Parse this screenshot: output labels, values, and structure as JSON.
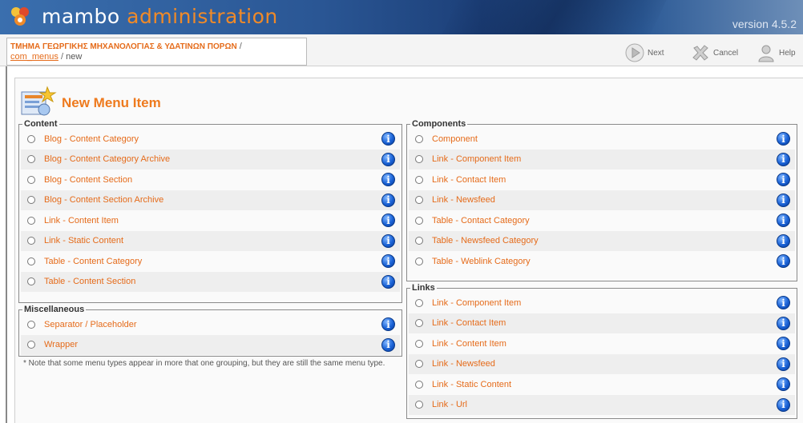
{
  "header": {
    "brand_main": "mambo ",
    "brand_accent": "administration",
    "version": "version 4.5.2"
  },
  "breadcrumb": {
    "site": "ΤΜΗΜΑ ΓΕΩΡΓΙΚΗΣ ΜΗΧΑΝΟΛΟΓΙΑΣ & ΥΔΑΤΙΝΩΝ ΠΟΡΩΝ",
    "separator": " / ",
    "component": "com_menus",
    "task": "new"
  },
  "toolbar": {
    "next": "Next",
    "cancel": "Cancel",
    "help": "Help"
  },
  "page": {
    "title": "New Menu Item",
    "note": "* Note that some menu types appear in more that one grouping, but they are still the same menu type."
  },
  "groups": {
    "content": {
      "legend": "Content",
      "items": [
        "Blog - Content Category",
        "Blog - Content Category Archive",
        "Blog - Content Section",
        "Blog - Content Section Archive",
        "Link - Content Item",
        "Link - Static Content",
        "Table - Content Category",
        "Table - Content Section"
      ]
    },
    "misc": {
      "legend": "Miscellaneous",
      "items": [
        "Separator / Placeholder",
        "Wrapper"
      ]
    },
    "components": {
      "legend": "Components",
      "items": [
        "Component",
        "Link - Component Item",
        "Link - Contact Item",
        "Link - Newsfeed",
        "Table - Contact Category",
        "Table - Newsfeed Category",
        "Table - Weblink Category"
      ]
    },
    "links": {
      "legend": "Links",
      "items": [
        "Link - Component Item",
        "Link - Contact Item",
        "Link - Content Item",
        "Link - Newsfeed",
        "Link - Static Content",
        "Link - Url"
      ]
    }
  },
  "icons": {
    "info": "info-icon",
    "next": "next-arrow-icon",
    "cancel": "cancel-x-icon",
    "help": "help-person-icon"
  },
  "colors": {
    "accent": "#e56b1a",
    "banner": "#2a5694",
    "info_blue": "#1a62d6"
  }
}
